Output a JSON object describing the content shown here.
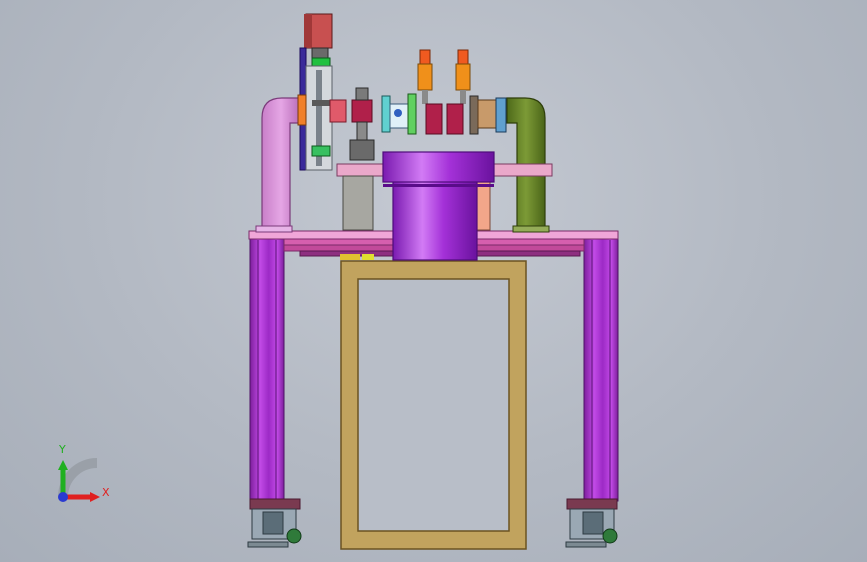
{
  "viewport": {
    "background": "#b8bec8"
  },
  "triad": {
    "x_label": "X",
    "y_label": "Y",
    "x_color": "#e02020",
    "y_color": "#20b020",
    "origin_color": "#2a3ad0"
  },
  "colors": {
    "frame_purple": "#b33ad8",
    "frame_purple_dark": "#6a1a86",
    "cylinder_purple": "#a12fd8",
    "rail_pink": "#d65fae",
    "table_pink": "#f0a6d8",
    "base_tan": "#c1a35e",
    "left_arch": "#d98bd8",
    "right_arch": "#5f7a25",
    "motor_red": "#c85050",
    "gray_block": "#a7a7a1"
  }
}
